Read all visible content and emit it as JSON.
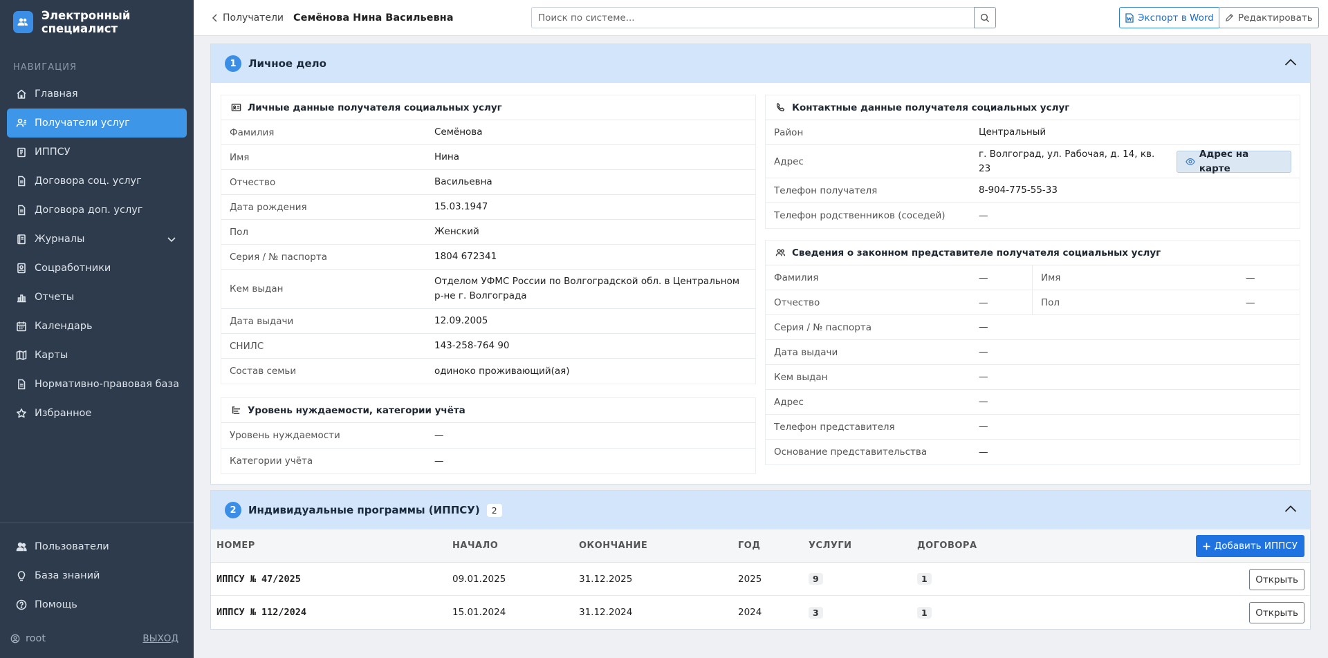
{
  "app": {
    "title": "Электронный специалист"
  },
  "nav": {
    "section_label": "НАВИГАЦИЯ",
    "items": [
      {
        "label": "Главная",
        "icon": "home-icon"
      },
      {
        "label": "Получатели услуг",
        "icon": "users-icon",
        "active": true
      },
      {
        "label": "ИППСУ",
        "icon": "clipboard-icon"
      },
      {
        "label": "Договора соц. услуг",
        "icon": "document-icon"
      },
      {
        "label": "Договора доп. услуг",
        "icon": "document-icon"
      },
      {
        "label": "Журналы",
        "icon": "book-icon"
      },
      {
        "label": "Соцработники",
        "icon": "badge-icon"
      },
      {
        "label": "Отчеты",
        "icon": "bar-chart-icon"
      },
      {
        "label": "Календарь",
        "icon": "calendar-icon"
      },
      {
        "label": "Карты",
        "icon": "map-icon"
      },
      {
        "label": "Нормативно-правовая база",
        "icon": "document-icon"
      },
      {
        "label": "Избранное",
        "icon": "star-icon"
      }
    ],
    "bottom_items": [
      {
        "label": "Пользователи",
        "icon": "users-icon"
      },
      {
        "label": "База знаний",
        "icon": "lightbulb-icon"
      },
      {
        "label": "Помощь",
        "icon": "help-icon"
      }
    ],
    "user": "root",
    "logout": "ВЫХОД"
  },
  "header": {
    "breadcrumb_back": "Получатели",
    "breadcrumb_current": "Семёнова Нина Васильевна",
    "search_placeholder": "Поиск по системе...",
    "export_label": "Экспорт в Word",
    "edit_label": "Редактировать"
  },
  "colors": {
    "accent": "#3a8ee6",
    "sidebar": "#2d3b4c",
    "panel_header": "#d3e5fa",
    "primary_button": "#1f73e0"
  },
  "section1": {
    "number": "1",
    "title": "Личное дело",
    "personal": {
      "title": "Личные данные получателя социальных услуг",
      "rows": [
        {
          "label": "Фамилия",
          "value": "Семёнова"
        },
        {
          "label": "Имя",
          "value": "Нина"
        },
        {
          "label": "Отчество",
          "value": "Васильевна"
        },
        {
          "label": "Дата рождения",
          "value": "15.03.1947"
        },
        {
          "label": "Пол",
          "value": "Женский"
        },
        {
          "label": "Серия / № паспорта",
          "value": "1804 672341"
        },
        {
          "label": "Кем выдан",
          "value": "Отделом УФМС России по Волгоградской обл. в Центральном р-не г. Волгограда"
        },
        {
          "label": "Дата выдачи",
          "value": "12.09.2005"
        },
        {
          "label": "СНИЛС",
          "value": "143-258-764 90"
        },
        {
          "label": "Состав семьи",
          "value": "одиноко проживающий(ая)"
        }
      ]
    },
    "need": {
      "title": "Уровень нуждаемости, категории учёта",
      "rows": [
        {
          "label": "Уровень нуждаемости",
          "value": "—"
        },
        {
          "label": "Категории учёта",
          "value": "—"
        }
      ]
    },
    "contacts": {
      "title": "Контактные данные получателя социальных услуг",
      "rows": [
        {
          "label": "Район",
          "value": "Центральный"
        },
        {
          "label": "Адрес",
          "value": "г. Волгоград, ул. Рабочая, д. 14, кв. 23"
        },
        {
          "label": "Телефон получателя",
          "value": "8-904-775-55-33"
        },
        {
          "label": "Телефон родственников (соседей)",
          "value": "—"
        }
      ],
      "map_button": "Адрес на карте"
    },
    "representative": {
      "title": "Сведения о законном представителе получателя социальных услуг",
      "half_rows": [
        [
          {
            "label": "Фамилия",
            "value": "—"
          },
          {
            "label": "Имя",
            "value": "—"
          }
        ],
        [
          {
            "label": "Отчество",
            "value": "—"
          },
          {
            "label": "Пол",
            "value": "—"
          }
        ]
      ],
      "rows": [
        {
          "label": "Серия / № паспорта",
          "value": "—"
        },
        {
          "label": "Дата выдачи",
          "value": "—"
        },
        {
          "label": "Кем выдан",
          "value": "—"
        },
        {
          "label": "Адрес",
          "value": "—"
        },
        {
          "label": "Телефон представителя",
          "value": "—"
        },
        {
          "label": "Основание представительства",
          "value": "—"
        }
      ]
    }
  },
  "section2": {
    "number": "2",
    "title": "Индивидуальные программы (ИППСУ)",
    "count": "2",
    "add_label": "Добавить ИППСУ",
    "columns": [
      "НОМЕР",
      "НАЧАЛО",
      "ОКОНЧАНИЕ",
      "ГОД",
      "УСЛУГИ",
      "ДОГОВОРА"
    ],
    "rows": [
      {
        "number": "ИППСУ № 47/2025",
        "start": "09.01.2025",
        "end": "31.12.2025",
        "year": "2025",
        "services": "9",
        "contracts": "1",
        "open": "Открыть"
      },
      {
        "number": "ИППСУ № 112/2024",
        "start": "15.01.2024",
        "end": "31.12.2024",
        "year": "2024",
        "services": "3",
        "contracts": "1",
        "open": "Открыть"
      }
    ]
  }
}
